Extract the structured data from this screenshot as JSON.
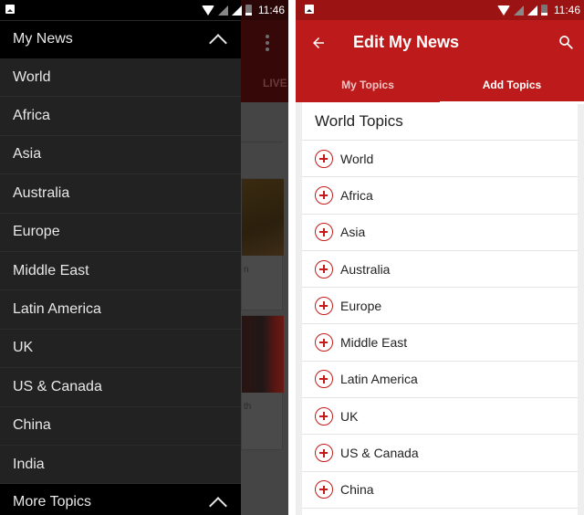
{
  "status_bar": {
    "time": "11:46"
  },
  "left_screen": {
    "background": {
      "tab_label_partial": "LIVE",
      "card1_text_partial": "n",
      "card2_text_partial": "th"
    },
    "drawer": {
      "title": "My News",
      "items": [
        {
          "label": "World"
        },
        {
          "label": "Africa"
        },
        {
          "label": "Asia"
        },
        {
          "label": "Australia"
        },
        {
          "label": "Europe"
        },
        {
          "label": "Middle East"
        },
        {
          "label": "Latin America"
        },
        {
          "label": "UK"
        },
        {
          "label": "US & Canada"
        },
        {
          "label": "China"
        },
        {
          "label": "India"
        }
      ],
      "footer_label": "More Topics"
    }
  },
  "right_screen": {
    "appbar": {
      "title": "Edit My News"
    },
    "tabs": [
      {
        "label": "My Topics",
        "active": false
      },
      {
        "label": "Add Topics",
        "active": true
      }
    ],
    "section_title": "World Topics",
    "topics": [
      {
        "label": "World"
      },
      {
        "label": "Africa"
      },
      {
        "label": "Asia"
      },
      {
        "label": "Australia"
      },
      {
        "label": "Europe"
      },
      {
        "label": "Middle East"
      },
      {
        "label": "Latin America"
      },
      {
        "label": "UK"
      },
      {
        "label": "US & Canada"
      },
      {
        "label": "China"
      }
    ]
  },
  "colors": {
    "brand_red": "#bd1b1b",
    "status_red": "#9b1313",
    "drawer_bg": "#222222",
    "plus_icon": "#c41a1a"
  }
}
